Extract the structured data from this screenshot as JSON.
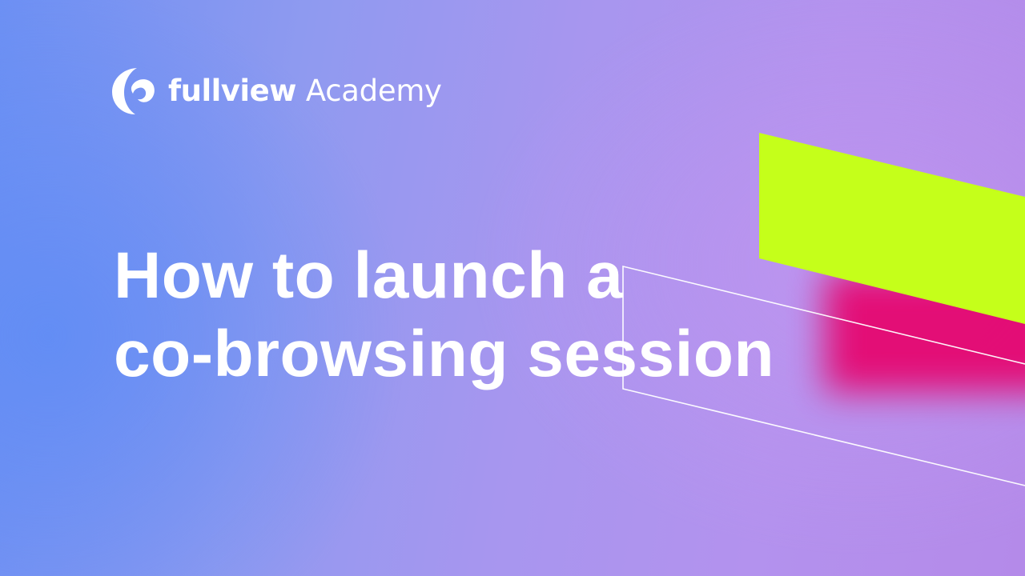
{
  "brand": {
    "name": "fullview",
    "suffix": "Academy",
    "logo_icon": "fullview-swirl-logo"
  },
  "headline": {
    "line1": "How to launch a",
    "line2": "co-browsing session"
  },
  "colors": {
    "text": "#ffffff",
    "accent_lime": "#c5ff1a",
    "accent_pink": "#e8006a",
    "background_start": "#6d90f3",
    "background_end": "#b48ae9"
  }
}
